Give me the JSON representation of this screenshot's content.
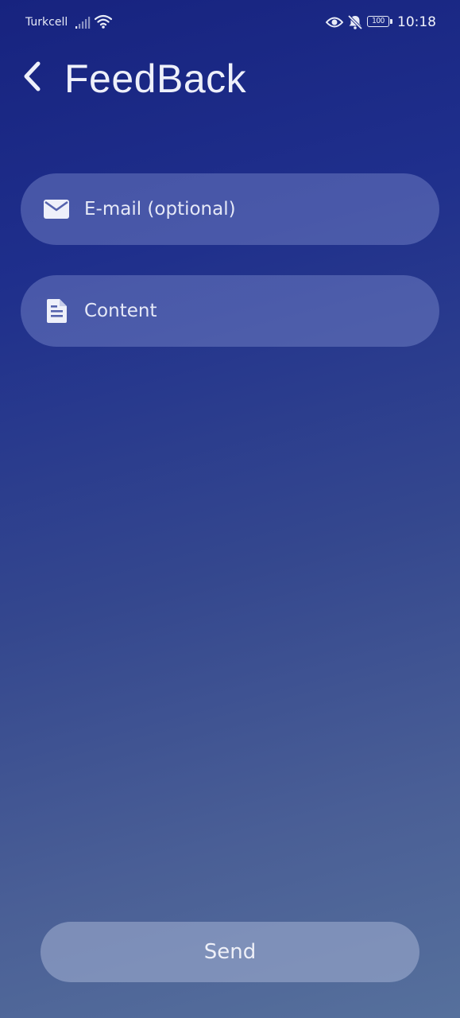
{
  "status_bar": {
    "carrier": "Turkcell",
    "battery_level": "100",
    "time": "10:18",
    "icons": [
      "signal-icon",
      "wifi-icon",
      "eye-icon",
      "bell-off-icon",
      "battery-icon"
    ]
  },
  "header": {
    "title": "FeedBack",
    "back_icon": "chevron-left-icon"
  },
  "form": {
    "email": {
      "placeholder": "E-mail (optional)",
      "value": "",
      "icon": "mail-icon"
    },
    "content": {
      "placeholder": "Content",
      "value": "",
      "icon": "document-icon"
    }
  },
  "actions": {
    "send_label": "Send"
  },
  "colors": {
    "background_top": "#17237f",
    "background_bottom": "#56709c",
    "field_fill": "#5a67b5",
    "button_fill": "#8796b8"
  }
}
